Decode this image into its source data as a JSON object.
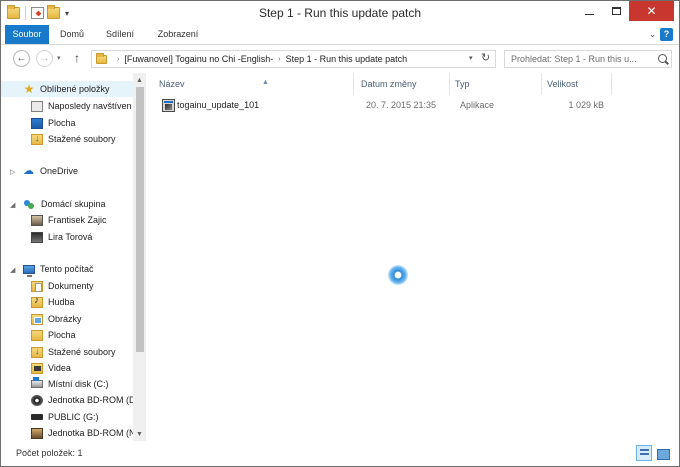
{
  "window": {
    "title": "Step 1 - Run this update patch"
  },
  "ribbon": {
    "tabs": [
      "Soubor",
      "Domů",
      "Sdílení",
      "Zobrazení"
    ],
    "help_label": "?"
  },
  "address_bar": {
    "crumbs": [
      "[Fuwanovel] Togainu no Chi -English-",
      "Step 1 - Run this update patch"
    ]
  },
  "search": {
    "placeholder": "Prohledat: Step 1 - Run this u..."
  },
  "nav_pane": {
    "favorites": {
      "label": "Oblíbené položky",
      "items": [
        "Naposledy navštíven",
        "Plocha",
        "Stažené soubory"
      ]
    },
    "onedrive": {
      "label": "OneDrive"
    },
    "homegroup": {
      "label": "Domácí skupina",
      "items": [
        "Frantisek Zajic",
        "Lira Torová"
      ]
    },
    "this_pc": {
      "label": "Tento počítač",
      "items": [
        "Dokumenty",
        "Hudba",
        "Obrázky",
        "Plocha",
        "Stažené soubory",
        "Videa",
        "Místní disk (C:)",
        "Jednotka BD-ROM (D",
        "PUBLIC (G:)",
        "Jednotka BD-ROM (N"
      ]
    }
  },
  "file_list": {
    "columns": {
      "name": "Název",
      "date": "Datum změny",
      "type": "Typ",
      "size": "Velikost"
    },
    "rows": [
      {
        "name": "togainu_update_101",
        "date": "20. 7. 2015 21:35",
        "type": "Aplikace",
        "size": "1 029 kB"
      }
    ]
  },
  "status_bar": {
    "item_count": "Počet položek: 1"
  }
}
